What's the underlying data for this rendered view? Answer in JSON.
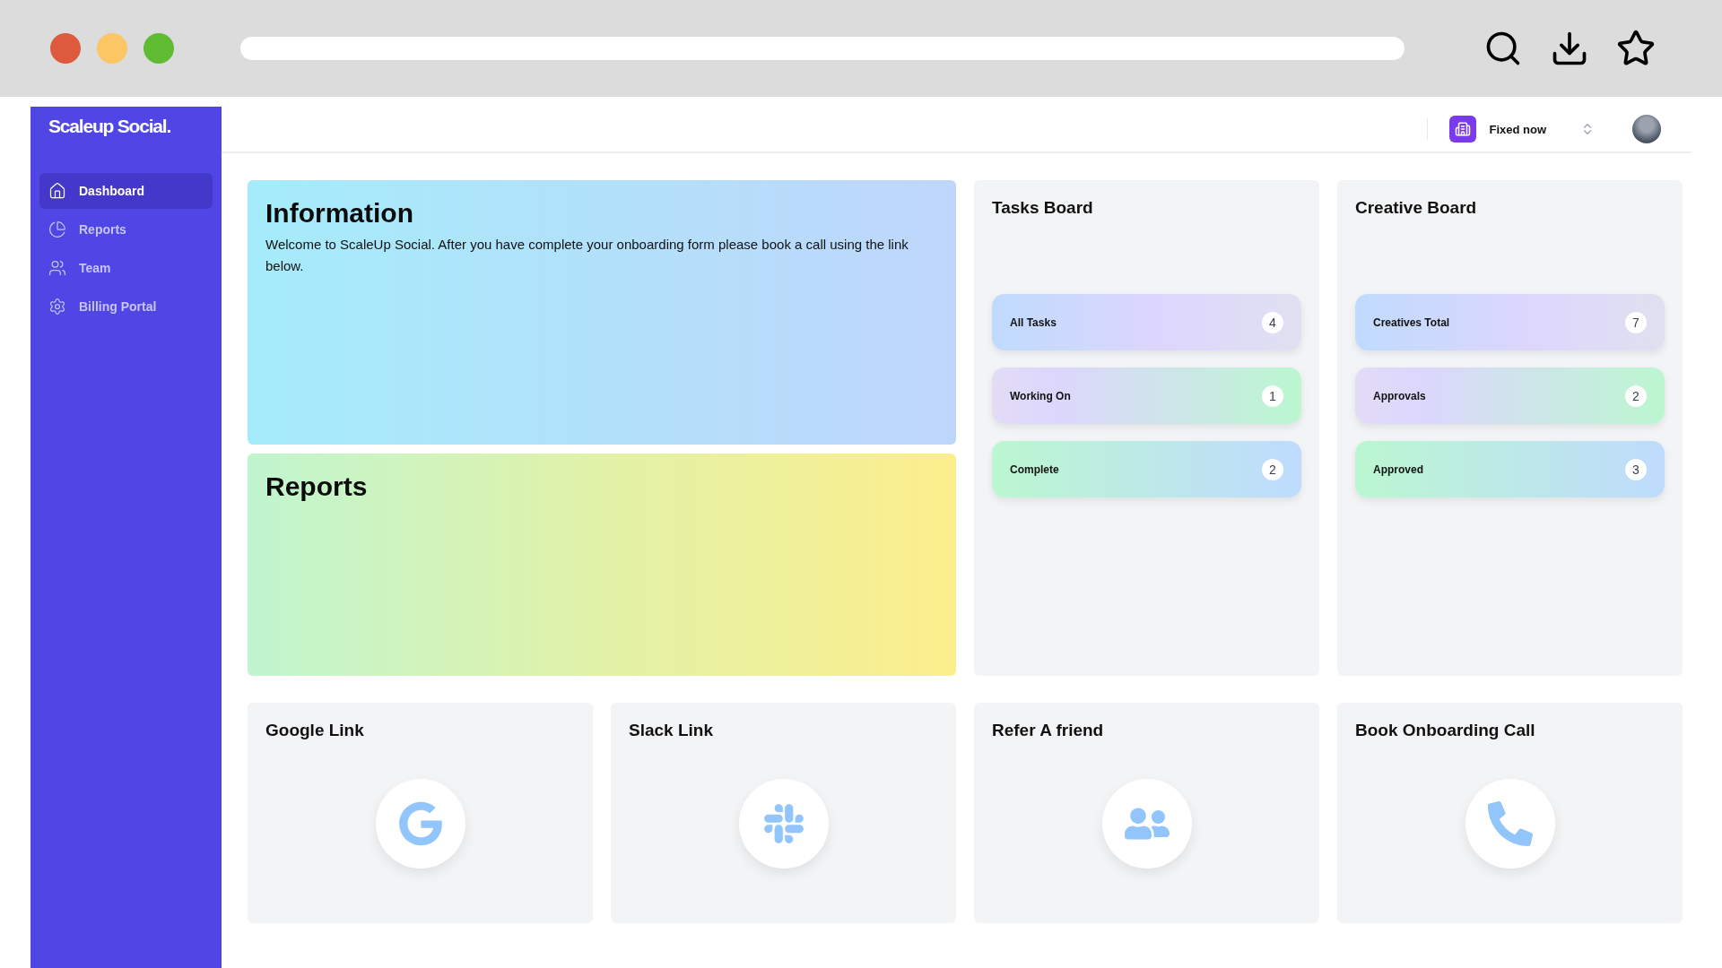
{
  "sidebar": {
    "logo": "Scaleup Social.",
    "items": [
      {
        "label": "Dashboard",
        "selected": true
      },
      {
        "label": "Reports",
        "selected": false
      },
      {
        "label": "Team",
        "selected": false
      },
      {
        "label": "Billing Portal",
        "selected": false
      }
    ]
  },
  "header": {
    "workspace": "Fixed now"
  },
  "information": {
    "title": "Information",
    "text": "Welcome to ScaleUp Social. After you have complete your onboarding form please book a call using the link below."
  },
  "reports": {
    "title": "Reports"
  },
  "boards": [
    {
      "title": "Tasks Board",
      "rows": [
        {
          "label": "All Tasks",
          "count": "4"
        },
        {
          "label": "Working On",
          "count": "1"
        },
        {
          "label": "Complete",
          "count": "2"
        }
      ]
    },
    {
      "title": "Creative Board",
      "rows": [
        {
          "label": "Creatives Total",
          "count": "7"
        },
        {
          "label": "Approvals",
          "count": "2"
        },
        {
          "label": "Approved",
          "count": "3"
        }
      ]
    }
  ],
  "links": [
    {
      "title": "Google Link"
    },
    {
      "title": "Slack Link"
    },
    {
      "title": "Refer A friend"
    },
    {
      "title": "Book Onboarding Call"
    }
  ]
}
